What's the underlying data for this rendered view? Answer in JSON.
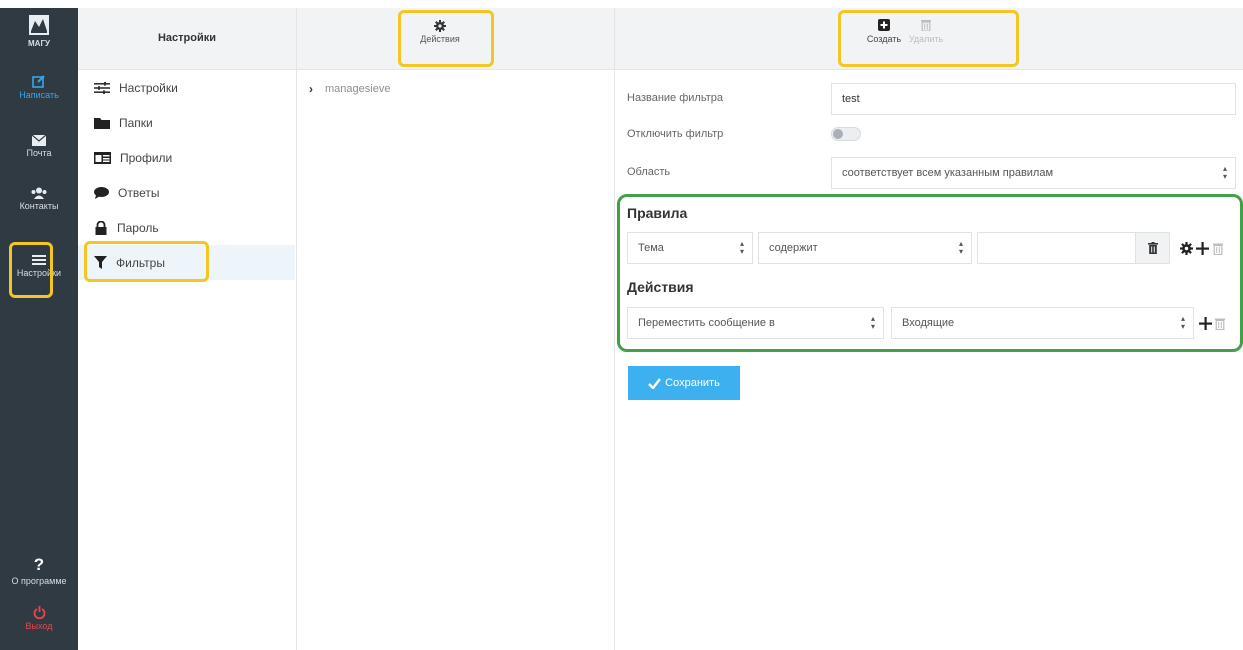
{
  "rail": {
    "logo_text": "МАГУ",
    "items": [
      {
        "label": "Написать",
        "icon": "compose-icon"
      },
      {
        "label": "Почта",
        "icon": "mail-icon"
      },
      {
        "label": "Контакты",
        "icon": "contacts-icon"
      },
      {
        "label": "Настройки",
        "icon": "settings-sliders-icon"
      },
      {
        "label": "О программе",
        "icon": "question-icon"
      },
      {
        "label": "Выход",
        "icon": "power-icon"
      }
    ]
  },
  "settings_pane": {
    "title": "Настройки",
    "items": [
      {
        "label": "Настройки",
        "icon": "sliders-icon"
      },
      {
        "label": "Папки",
        "icon": "folder-icon"
      },
      {
        "label": "Профили",
        "icon": "id-card-icon"
      },
      {
        "label": "Ответы",
        "icon": "comment-icon"
      },
      {
        "label": "Пароль",
        "icon": "lock-icon"
      },
      {
        "label": "Фильтры",
        "icon": "filter-icon",
        "active": true
      }
    ]
  },
  "filter_sets": {
    "actions_label": "Действия",
    "items": [
      {
        "label": "managesieve"
      }
    ]
  },
  "toolbar": {
    "create_label": "Создать",
    "delete_label": "Удалить"
  },
  "form": {
    "name_label": "Название фильтра",
    "name_value": "test",
    "disable_label": "Отключить фильтр",
    "disabled": false,
    "scope_label": "Область",
    "scope_value": "соответствует всем указанным правилам",
    "rules_title": "Правила",
    "rule": {
      "header": "Тема",
      "operator": "содержит",
      "value": ""
    },
    "actions_title": "Действия",
    "action": {
      "type": "Переместить сообщение в",
      "target": "Входящие"
    },
    "save_label": "Сохранить"
  },
  "colors": {
    "rail_bg": "#2f3a43",
    "accent_blue": "#3db1f0",
    "highlight_yellow": "#f3c624",
    "highlight_green": "#43a047",
    "danger": "#e7474b"
  }
}
